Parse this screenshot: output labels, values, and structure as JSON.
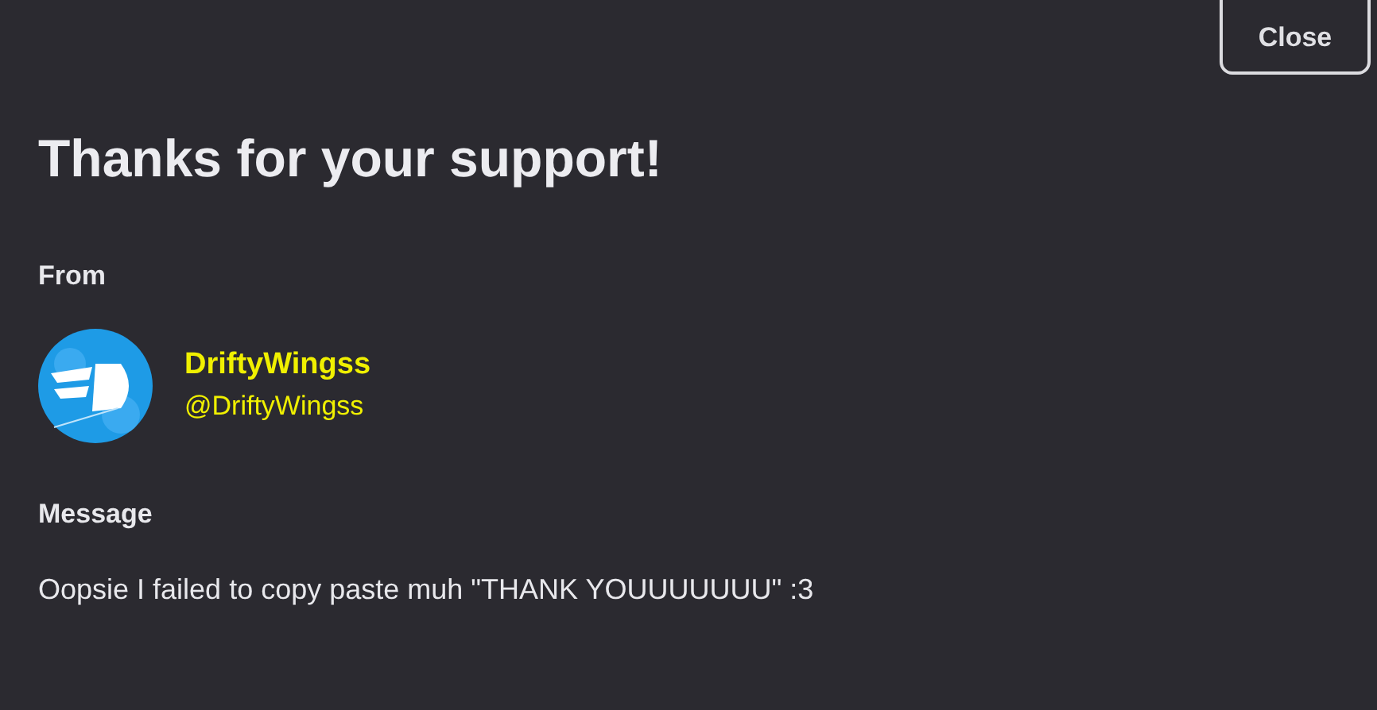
{
  "close_button": "Close",
  "title": "Thanks for your support!",
  "from": {
    "label": "From",
    "display_name": "DriftyWingss",
    "handle": "@DriftyWingss"
  },
  "message": {
    "label": "Message",
    "text": "Oopsie I failed to copy paste muh \"THANK YOUUUUUUU\" :3"
  }
}
